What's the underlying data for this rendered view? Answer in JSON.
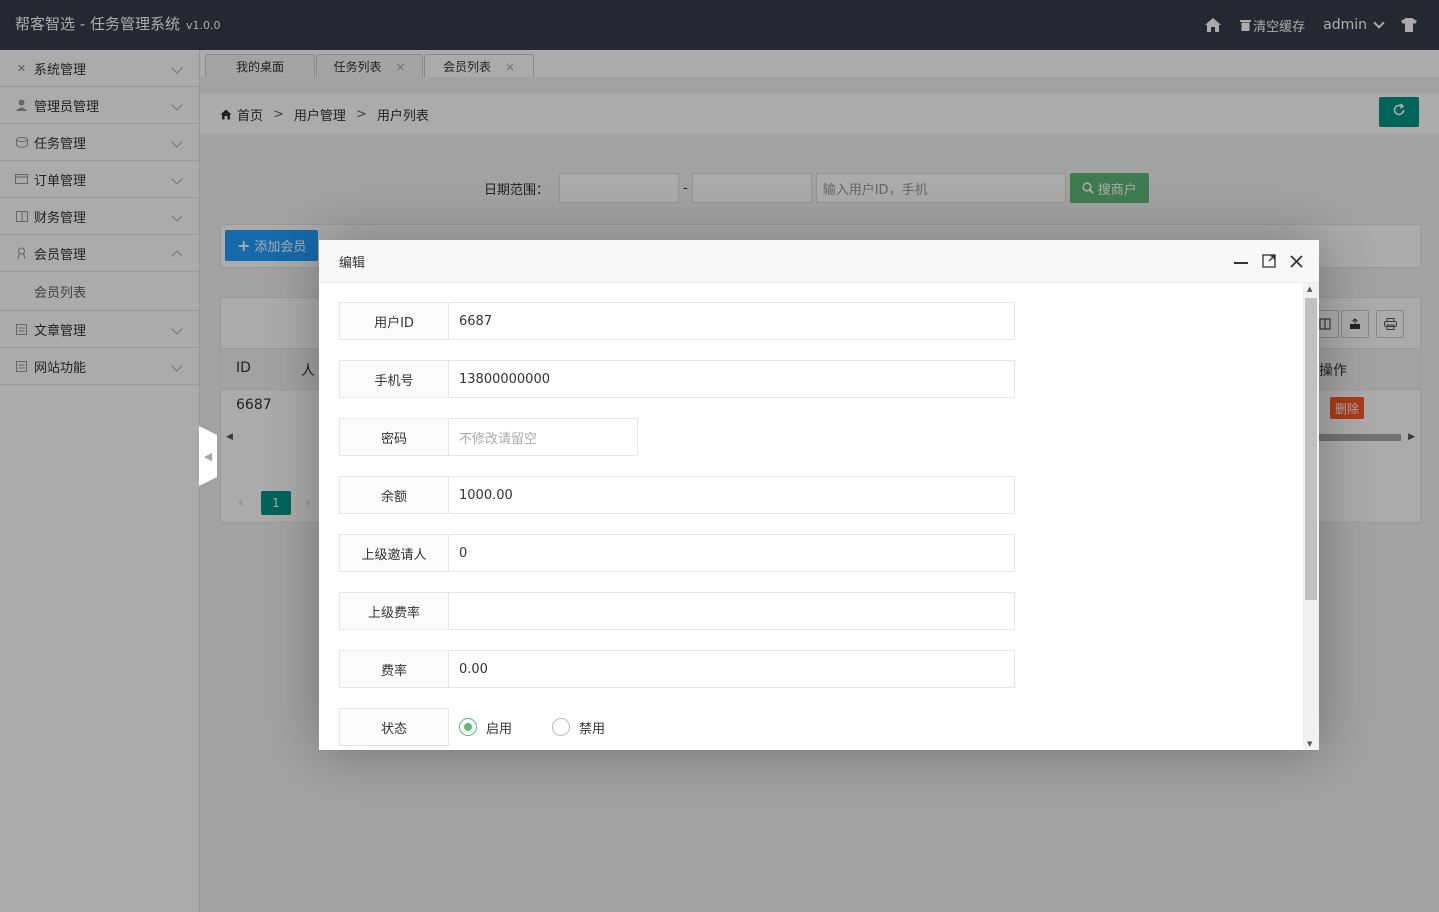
{
  "header": {
    "app_title": "帮客智选 - 任务管理系统",
    "version": "v1.0.0",
    "clear_cache": "清空缓存",
    "user": "admin"
  },
  "sidebar": {
    "items": [
      {
        "label": "系统管理",
        "icon": "tools-icon"
      },
      {
        "label": "管理员管理",
        "icon": "user-icon"
      },
      {
        "label": "任务管理",
        "icon": "database-icon"
      },
      {
        "label": "订单管理",
        "icon": "card-icon"
      },
      {
        "label": "财务管理",
        "icon": "book-icon"
      },
      {
        "label": "会员管理",
        "icon": "member-icon"
      },
      {
        "label": "文章管理",
        "icon": "doc-icon"
      },
      {
        "label": "网站功能",
        "icon": "doc-icon"
      }
    ],
    "sub_items": [
      "会员列表"
    ]
  },
  "tabs": [
    {
      "label": "我的桌面",
      "closable": false
    },
    {
      "label": "任务列表",
      "closable": true
    },
    {
      "label": "会员列表",
      "closable": true
    }
  ],
  "breadcrumb": {
    "home": "首页",
    "level1": "用户管理",
    "level2": "用户列表",
    "separator": ">"
  },
  "search": {
    "date_label": "日期范围：",
    "date_sep": "-",
    "keyword_placeholder": "输入用户ID，手机",
    "button": "搜商户"
  },
  "toolbar": {
    "add_button": "添加会员"
  },
  "table": {
    "headers": [
      "ID",
      "人",
      "操作"
    ],
    "rows": [
      {
        "id": "6687"
      }
    ],
    "delete_label": "删除",
    "current_page": "1"
  },
  "modal": {
    "title": "编辑",
    "fields": [
      {
        "label": "用户ID",
        "value": "6687",
        "placeholder": ""
      },
      {
        "label": "手机号",
        "value": "13800000000",
        "placeholder": ""
      },
      {
        "label": "密码",
        "value": "",
        "placeholder": "不修改请留空"
      },
      {
        "label": "余额",
        "value": "1000.00",
        "placeholder": ""
      },
      {
        "label": "上级邀请人",
        "value": "0",
        "placeholder": ""
      },
      {
        "label": "上级费率",
        "value": "",
        "placeholder": ""
      },
      {
        "label": "费率",
        "value": "0.00",
        "placeholder": ""
      }
    ],
    "status": {
      "label": "状态",
      "options": [
        "启用",
        "禁用"
      ],
      "selected": "启用"
    }
  },
  "colors": {
    "header_bg": "#393d49",
    "primary_teal": "#009688",
    "green": "#5fb878",
    "blue": "#1e9fff",
    "danger": "#ff5722"
  }
}
